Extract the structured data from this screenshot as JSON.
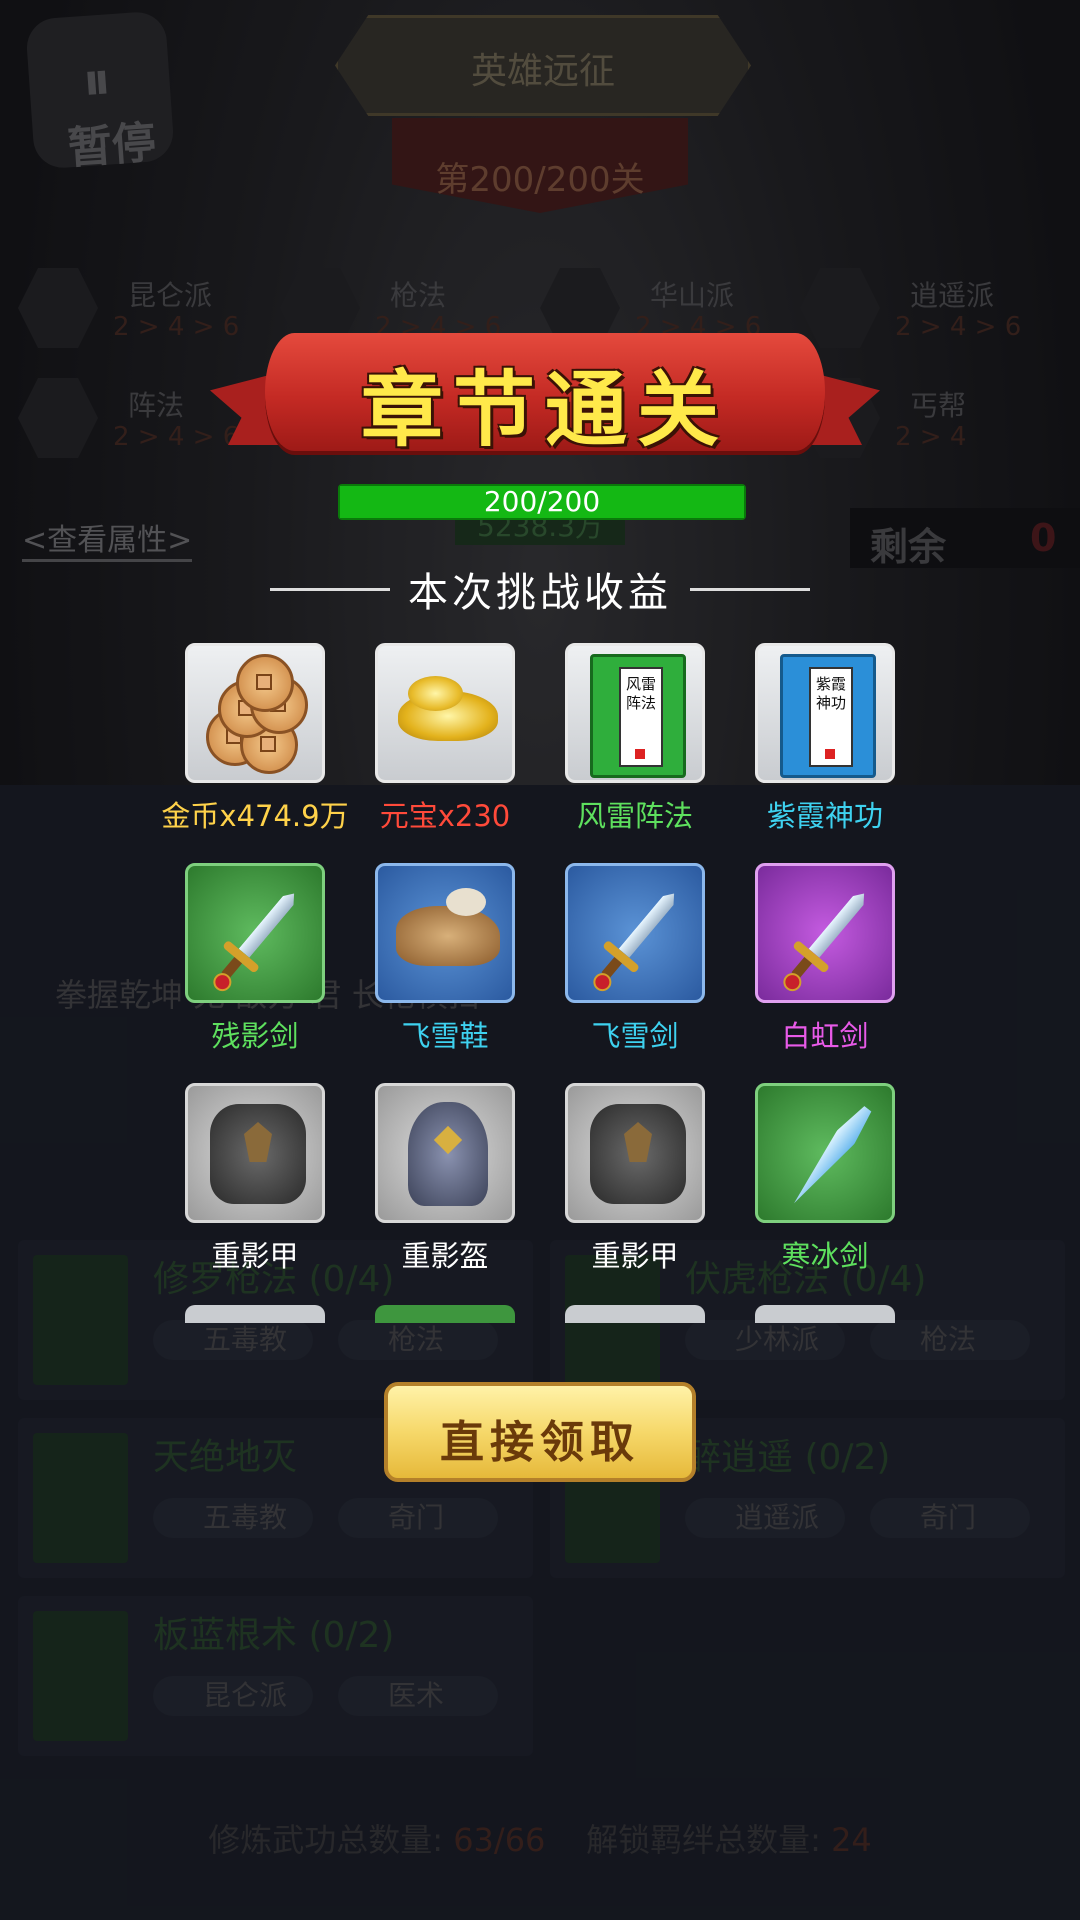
{
  "background": {
    "pause_label": "暂停",
    "mode_title": "英雄远征",
    "stage": "第200/200关",
    "factions": [
      {
        "name": "昆仑派",
        "value": "2 > 4 > 6"
      },
      {
        "name": "枪法",
        "value": "2 > 4 > 6"
      },
      {
        "name": "华山派",
        "value": "2 > 4 > 6"
      },
      {
        "name": "逍遥派",
        "value": "2 > 4 > 6"
      },
      {
        "name": "阵法",
        "value": "2 > 4 > 6"
      },
      {
        "name": "丐帮",
        "value": "2 > 4"
      }
    ],
    "view_attributes": "<查看属性>",
    "power": "5238.3万",
    "remaining_label": "剩余",
    "remaining_value": "0",
    "skill_row": "拳握乾坤   无  敌方   君   长枪横扫",
    "cards": [
      {
        "name": "修罗枪法 (0/4)",
        "tags": [
          "五毒教",
          "枪法"
        ]
      },
      {
        "name": "伏虎枪法 (0/4)",
        "tags": [
          "少林派",
          "枪法"
        ]
      },
      {
        "name": "天绝地灭",
        "tags": [
          "五毒教",
          "奇门"
        ]
      },
      {
        "name": "醉逍遥  (0/2)",
        "tags": [
          "逍遥派",
          "奇门"
        ]
      },
      {
        "name": "板蓝根术 (0/2)",
        "tags": [
          "昆仑派",
          "医术"
        ]
      }
    ],
    "totals_label_1": "修炼武功总数量:",
    "totals_value_1": "63/66",
    "totals_label_2": "解锁羁绊总数量:",
    "totals_value_2": "24"
  },
  "banner_title": "章节通关",
  "progress": {
    "label": "200/200",
    "fraction": 1.0
  },
  "rewards_title": "本次挑战收益",
  "rewards": [
    {
      "name": "金币x474.9万",
      "icon": "coins-icon",
      "quality": "white",
      "color": "#ffd24a"
    },
    {
      "name": "元宝x230",
      "icon": "gold-ingot-icon",
      "quality": "white",
      "color": "#ff4a3a"
    },
    {
      "name": "风雷阵法",
      "icon": "green-manual-icon",
      "quality": "white",
      "color": "#5ee05e",
      "book_text": "风雷阵法"
    },
    {
      "name": "紫霞神功",
      "icon": "blue-manual-icon",
      "quality": "white",
      "color": "#3ed2f0",
      "book_text": "紫霞神功"
    },
    {
      "name": "残影剑",
      "icon": "sword-icon",
      "quality": "green",
      "color": "#5ee05e"
    },
    {
      "name": "飞雪鞋",
      "icon": "boots-icon",
      "quality": "blue",
      "color": "#3ed2f0"
    },
    {
      "name": "飞雪剑",
      "icon": "sword-icon",
      "quality": "blue",
      "color": "#3ed2f0"
    },
    {
      "name": "白虹剑",
      "icon": "sword-icon",
      "quality": "purple",
      "color": "#e85ae8"
    },
    {
      "name": "重影甲",
      "icon": "armor-icon",
      "quality": "grey",
      "color": "#ffffff"
    },
    {
      "name": "重影盔",
      "icon": "helmet-icon",
      "quality": "grey",
      "color": "#ffffff"
    },
    {
      "name": "重影甲",
      "icon": "armor-icon",
      "quality": "grey",
      "color": "#ffffff"
    },
    {
      "name": "寒冰剑",
      "icon": "ice-sword-icon",
      "quality": "green",
      "color": "#5ee05e"
    }
  ],
  "claim_button": "直接领取"
}
